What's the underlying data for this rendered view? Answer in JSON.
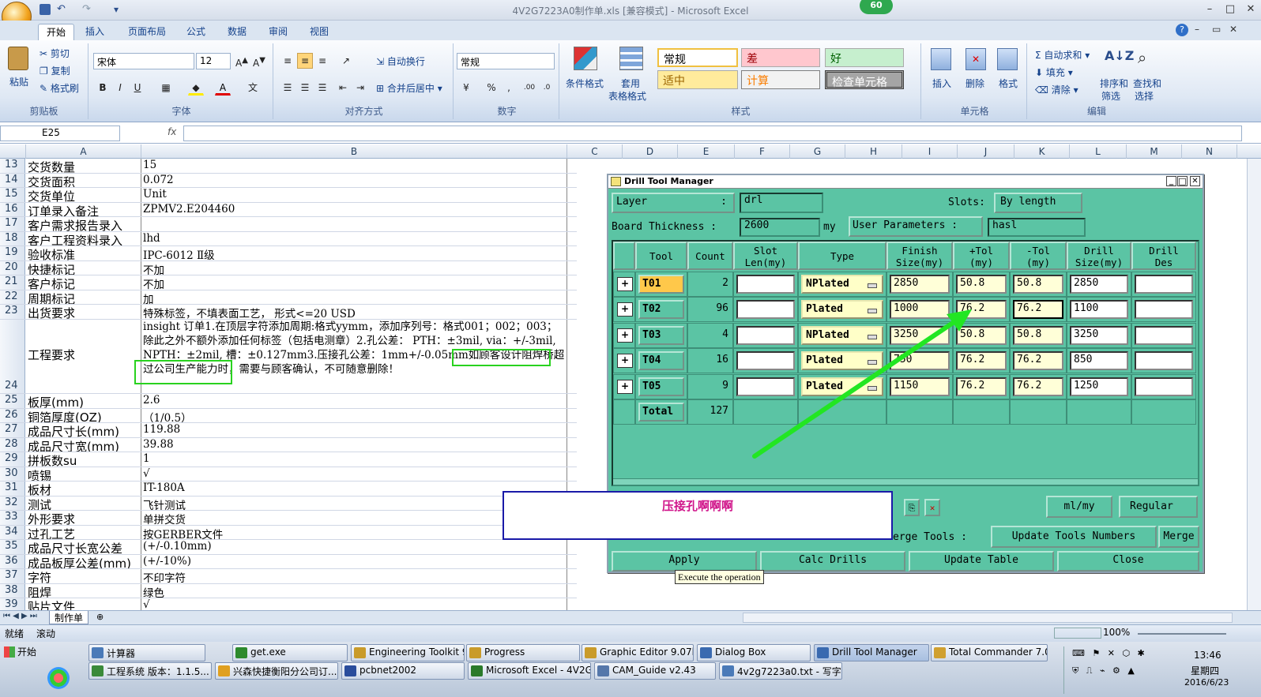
{
  "window": {
    "title": "4V2G7223A0制作单.xls  [兼容模式] - Microsoft Excel",
    "badge": "60"
  },
  "tabs": [
    "开始",
    "插入",
    "页面布局",
    "公式",
    "数据",
    "审阅",
    "视图"
  ],
  "ribbon": {
    "clipboard": {
      "label": "剪贴板",
      "paste": "粘贴",
      "cut": "剪切",
      "copy": "复制",
      "format_painter": "格式刷"
    },
    "font": {
      "label": "字体",
      "name": "宋体",
      "size": "12"
    },
    "alignment": {
      "label": "对齐方式",
      "wrap": "自动换行",
      "merge": "合并后居中"
    },
    "number": {
      "label": "数字",
      "format": "常规"
    },
    "styles": {
      "label": "样式",
      "conditional": "条件格式",
      "table1": "套用",
      "table2": "表格格式",
      "normal": "常规",
      "bad": "差",
      "good": "好",
      "neutral": "适中",
      "calc": "计算",
      "check": "检查单元格"
    },
    "cells": {
      "label": "单元格",
      "insert": "插入",
      "delete": "删除",
      "format": "格式"
    },
    "editing": {
      "label": "编辑",
      "autosum": "自动求和",
      "fill": "填充",
      "clear": "清除",
      "sort1": "排序和",
      "sort2": "筛选",
      "find1": "查找和",
      "find2": "选择"
    }
  },
  "formula": {
    "namebox": "E25",
    "fx": "fx"
  },
  "columns": [
    "A",
    "B",
    "C",
    "D",
    "E",
    "F",
    "G",
    "H",
    "I",
    "J",
    "K",
    "L",
    "M",
    "N"
  ],
  "rows": [
    {
      "n": "13",
      "a": "交货数量",
      "b": "15"
    },
    {
      "n": "14",
      "a": "交货面积",
      "b": "0.072"
    },
    {
      "n": "15",
      "a": "交货单位",
      "b": "Unit"
    },
    {
      "n": "16",
      "a": "订单录入备注",
      "b": "ZPMV2.E204460"
    },
    {
      "n": "17",
      "a": "客户需求报告录入",
      "b": ""
    },
    {
      "n": "18",
      "a": "客户工程资料录入",
      "b": "lhd"
    },
    {
      "n": "19",
      "a": "验收标准",
      "b": "IPC-6012 Ⅱ级"
    },
    {
      "n": "20",
      "a": "快捷标记",
      "b": "不加"
    },
    {
      "n": "21",
      "a": "客户标记",
      "b": "不加"
    },
    {
      "n": "22",
      "a": "周期标记",
      "b": "加"
    },
    {
      "n": "23",
      "a": "出货要求",
      "b": "特殊标签，不填表面工艺， 形式<=20 USD"
    },
    {
      "n": "24",
      "a": "工程要求",
      "b": "insight 订单1.在顶层字符添加周期:格式yymm，添加序列号：格式001；002；003；除此之外不额外添加任何标签（包括电测章）2.孔公差： PTH：±3mil, via：+/-3mil, NPTH：±2mil, 槽：±0.127mm3.压接孔公差：1mm+/-0.05mm如顾客设计阻焊桥超过公司生产能力时，需要与顾客确认，不可随意删除！"
    },
    {
      "n": "25",
      "a": "板厚(mm)",
      "b": "2.6"
    },
    {
      "n": "26",
      "a": "铜箔厚度(OZ)",
      "b": "（1/0.5）"
    },
    {
      "n": "27",
      "a": "成品尺寸长(mm)",
      "b": "119.88"
    },
    {
      "n": "28",
      "a": "成品尺寸宽(mm)",
      "b": "39.88"
    },
    {
      "n": "29",
      "a": "拼板数su",
      "b": "1"
    },
    {
      "n": "30",
      "a": "喷锡",
      "b": "√"
    },
    {
      "n": "31",
      "a": "板材",
      "b": "IT-180A"
    },
    {
      "n": "32",
      "a": "测试",
      "b": "飞针测试"
    },
    {
      "n": "33",
      "a": "外形要求",
      "b": "单拼交货"
    },
    {
      "n": "34",
      "a": "过孔工艺",
      "b": "按GERBER文件"
    },
    {
      "n": "35",
      "a": "成品尺寸长宽公差",
      "b": "(+/-0.10mm)"
    },
    {
      "n": "36",
      "a": "成品板厚公差(mm)",
      "b": "(+/-10%)"
    },
    {
      "n": "37",
      "a": "字符",
      "b": "不印字符"
    },
    {
      "n": "38",
      "a": "阻焊",
      "b": "绿色"
    },
    {
      "n": "39",
      "a": "贴片文件",
      "b": "√"
    }
  ],
  "sheet_tab": "制作单",
  "status": {
    "ready": "就绪",
    "scroll": "滚动",
    "zoom": "100%"
  },
  "dialog": {
    "title": "Drill Tool Manager",
    "layer_label": "Layer",
    "layer_value": "drl",
    "slots_label": "Slots:",
    "slots_value": "By length",
    "thickness_label": "Board Thickness :",
    "thickness_value": "2600",
    "thickness_unit": "my",
    "user_params_label": "User Parameters :",
    "user_params_value": "hasl",
    "headers": [
      "Tool",
      "Count",
      "Slot\nLen(my)",
      "Type",
      "Finish\nSize(my)",
      "+Tol\n(my)",
      "-Tol\n(my)",
      "Drill\nSize(my)",
      "Drill\nDes"
    ],
    "tools": [
      {
        "tool": "T01",
        "count": "2",
        "type": "NPlated",
        "finish": "2850",
        "ptol": "50.8",
        "ntol": "50.8",
        "drill": "2850"
      },
      {
        "tool": "T02",
        "count": "96",
        "type": "Plated",
        "finish": "1000",
        "ptol": "76.2",
        "ntol": "76.2",
        "drill": "1100"
      },
      {
        "tool": "T03",
        "count": "4",
        "type": "NPlated",
        "finish": "3250",
        "ptol": "50.8",
        "ntol": "50.8",
        "drill": "3250"
      },
      {
        "tool": "T04",
        "count": "16",
        "type": "Plated",
        "finish": "750",
        "ptol": "76.2",
        "ntol": "76.2",
        "drill": "850"
      },
      {
        "tool": "T05",
        "count": "9",
        "type": "Plated",
        "finish": "1150",
        "ptol": "76.2",
        "ntol": "76.2",
        "drill": "1250"
      }
    ],
    "total_label": "Total",
    "total_count": "127",
    "units": "ml/my",
    "mode": "Regular",
    "merge_label": "erge Tools :",
    "update_numbers": "Update Tools Numbers",
    "merge": "Merge",
    "apply": "Apply",
    "calc": "Calc Drills",
    "update": "Update Table",
    "close": "Close",
    "tooltip": "Execute the operation"
  },
  "note": "压接孔啊啊啊",
  "taskbar": {
    "start": "开始",
    "row1": [
      "计算器",
      "get.exe",
      "Engineering Toolkit 9.0...",
      "Progress",
      "Graphic Editor 9.07b2 ...",
      "Dialog Box",
      "Drill Tool Manager",
      "Total Commander 7.0 ..."
    ],
    "row2": [
      "工程系统  版本：1.1.5...",
      "兴森快捷衡阳分公司订...",
      "pcbnet2002",
      "Microsoft Excel - 4V2G72...",
      "CAM_Guide v2.43",
      "4v2g7223a0.txt - 写字板"
    ],
    "time": "13:46",
    "day": "星期四",
    "date": "2016/6/23"
  },
  "colors": {
    "dialog": "#5bc4a4",
    "arrow": "#22e622",
    "note_text": "#d0148a"
  }
}
